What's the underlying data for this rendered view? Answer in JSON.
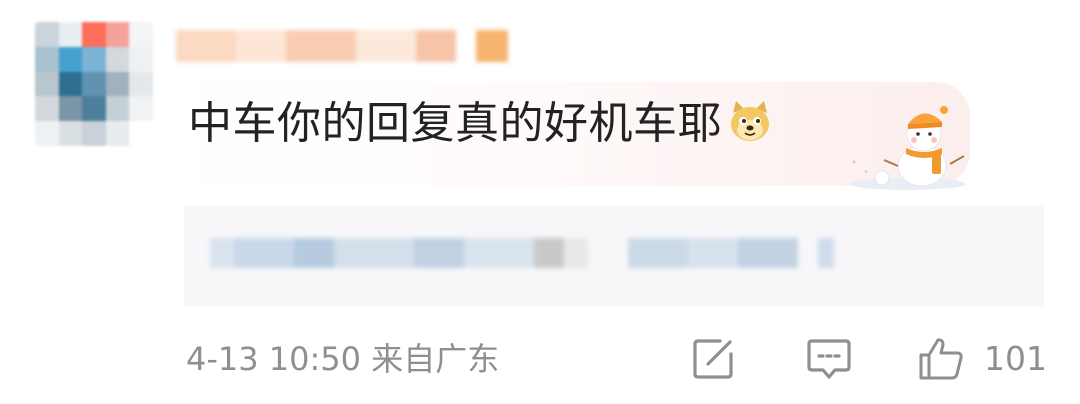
{
  "comment": {
    "text": "中车你的回复真的好机车耶",
    "emoji": "doge-emoji",
    "decoration": "snowman-decoration"
  },
  "footer": {
    "time": "4-13 10:50",
    "location": "来自广东",
    "likes": "101"
  },
  "icons": {
    "reply": "share-edit-icon",
    "comment": "comment-icon",
    "like": "thumbs-up-icon"
  },
  "colors": {
    "text": "#222222",
    "meta": "#8f8f8f",
    "quote_bg": "#f7f7f9",
    "snowman_scarf": "#f39a2e"
  }
}
